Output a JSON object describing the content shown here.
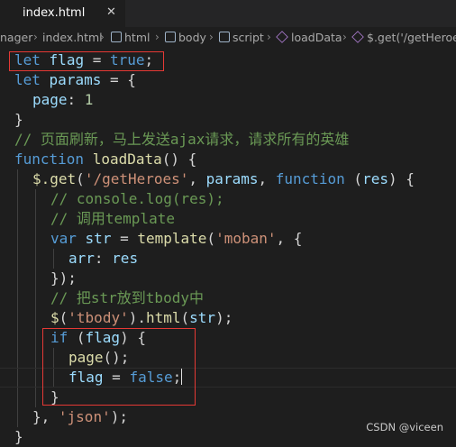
{
  "tab": {
    "filename": "index.html",
    "close": "✕"
  },
  "breadcrumb": {
    "items": [
      "nager",
      "index.html",
      "html",
      "body",
      "script",
      "loadData",
      "$.get('/getHeroes"
    ]
  },
  "code": {
    "l1": {
      "kw": "let",
      "id": "flag",
      "op": " = ",
      "val": "true",
      "end": ";"
    },
    "l2": {
      "kw": "let",
      "id": "params",
      "rest": " = {"
    },
    "l3": {
      "key": "page",
      "colon": ": ",
      "num": "1"
    },
    "l4": {
      "text": "}"
    },
    "l5": {
      "comment": "// 页面刷新，马上发送ajax请求，请求所有的英雄"
    },
    "l6": {
      "kw": "function",
      "fn": "loadData",
      "rest": "() {"
    },
    "l7": {
      "obj": "$",
      "fn": ".get",
      "p1": "(",
      "str": "'/getHeroes'",
      "p2": ", ",
      "id": "params",
      "p3": ", ",
      "kw": "function",
      "p4": " (",
      "arg": "res",
      "p5": ") {"
    },
    "l8": {
      "comment": "// console.log(res);"
    },
    "l9": {
      "comment": "// 调用template"
    },
    "l10": {
      "kw": "var",
      "id": "str",
      "op": " = ",
      "fn": "template",
      "p1": "(",
      "str": "'moban'",
      "p2": ", {"
    },
    "l11": {
      "key": "arr",
      "colon": ": ",
      "id": "res"
    },
    "l12": {
      "text": "});"
    },
    "l13": {
      "comment": "// 把str放到tbody中"
    },
    "l14": {
      "fn": "$",
      "p1": "(",
      "str": "'tbody'",
      "p2": ").",
      "fn2": "html",
      "p3": "(",
      "id": "str",
      "p4": ");"
    },
    "l15": {
      "kw": "if",
      "p1": " (",
      "id": "flag",
      "p2": ") {"
    },
    "l16": {
      "fn": "page",
      "p1": "();"
    },
    "l17": {
      "id": "flag",
      "op": " = ",
      "kw": "false",
      "end": ";"
    },
    "l18": {
      "text": "}"
    },
    "l19": {
      "p1": "}, ",
      "str": "'json'",
      "p2": ");"
    },
    "l20": {
      "text": "}"
    }
  },
  "watermark": "CSDN @viceen",
  "colors": {
    "highlight_box": "#e53935",
    "keyword": "#569cd6",
    "string": "#ce9178",
    "comment": "#6a9955"
  }
}
